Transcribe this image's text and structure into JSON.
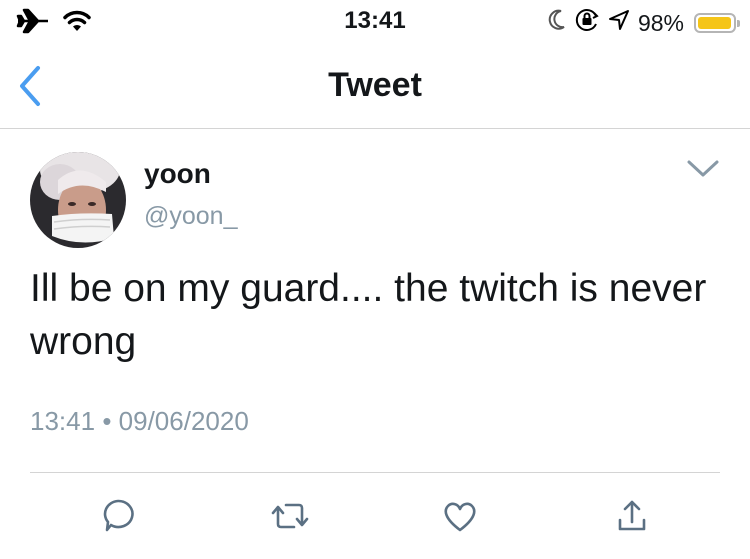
{
  "status_bar": {
    "time": "13:41",
    "battery_text": "98%",
    "battery_level": 0.98,
    "battery_color": "#f5c518",
    "icons": [
      "airplane-icon",
      "wifi-icon",
      "moon-icon",
      "orientation-lock-icon",
      "location-icon",
      "battery-icon"
    ]
  },
  "nav": {
    "title": "Tweet",
    "back_icon": "chevron-left-icon",
    "accent_color": "#4a9df0"
  },
  "tweet": {
    "display_name": "yoon",
    "handle": "@yoon_",
    "text": "Ill be on my guard.... the twitch is never wrong",
    "time": "13:41",
    "separator": "•",
    "date": "09/06/2020",
    "menu_icon": "chevron-down-icon"
  },
  "actions": [
    {
      "icon": "reply-icon"
    },
    {
      "icon": "retweet-icon"
    },
    {
      "icon": "like-icon"
    },
    {
      "icon": "share-icon"
    }
  ],
  "colors": {
    "text": "#14171a",
    "secondary": "#8899a6",
    "icon": "#5b7083",
    "divider": "#d4d4d4"
  }
}
